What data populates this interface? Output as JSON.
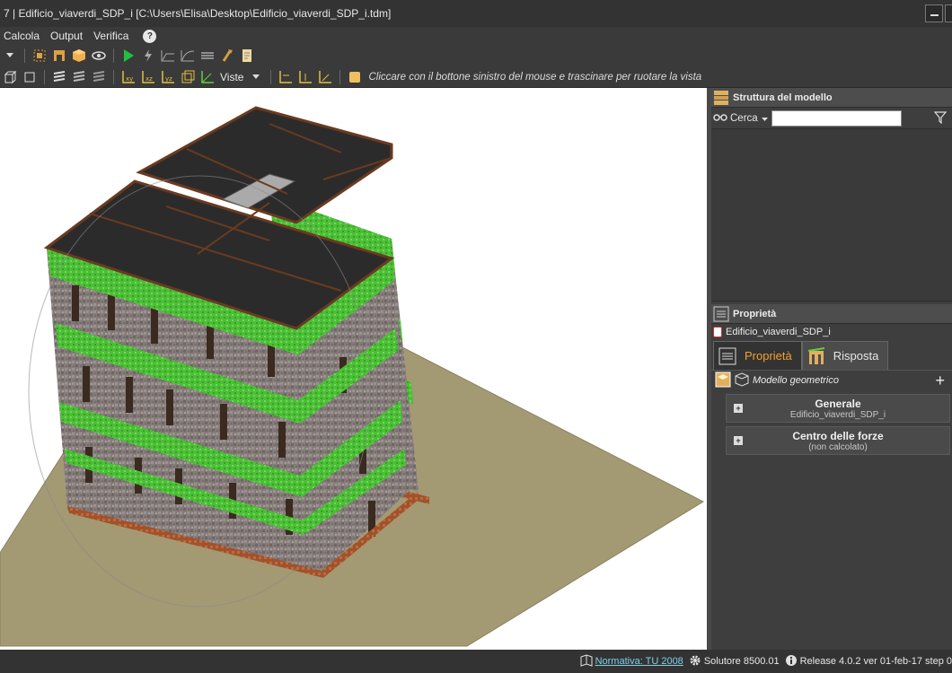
{
  "window": {
    "title": "7 | Edificio_viaverdi_SDP_i [C:\\Users\\Elisa\\Desktop\\Edificio_viaverdi_SDP_i.tdm]"
  },
  "menu": {
    "items": [
      "Calcola",
      "Output",
      "Verifica"
    ],
    "help": "?"
  },
  "toolbar2": {
    "viste_label": "Viste",
    "hint": "Cliccare con il bottone sinistro del mouse e trascinare per ruotare la vista"
  },
  "structure_panel": {
    "title": "Struttura del modello",
    "search_label": "Cerca",
    "search_value": ""
  },
  "properties_panel": {
    "title": "Proprietà",
    "object_name": "Edificio_viaverdi_SDP_i",
    "tabs": [
      {
        "label": "Proprietà",
        "active": true
      },
      {
        "label": "Risposta",
        "active": false
      }
    ],
    "geometry_label": "Modello geometrico",
    "sections": [
      {
        "title": "Generale",
        "subtitle": "Edificio_viaverdi_SDP_i"
      },
      {
        "title": "Centro delle forze",
        "subtitle": "(non calcolato)"
      }
    ]
  },
  "status": {
    "normativa": "Normativa: TU 2008",
    "solutore": "Solutore 8500.01",
    "release": "Release 4.0.2 ver 01-feb-17 step 0"
  },
  "colors": {
    "roof": "#2b2b2b",
    "ring_beam": "#4fc23a",
    "masonry": "#7a7070",
    "foundation": "#a0522d",
    "ground": "#a39a73",
    "active_tab": "#f0a030"
  }
}
